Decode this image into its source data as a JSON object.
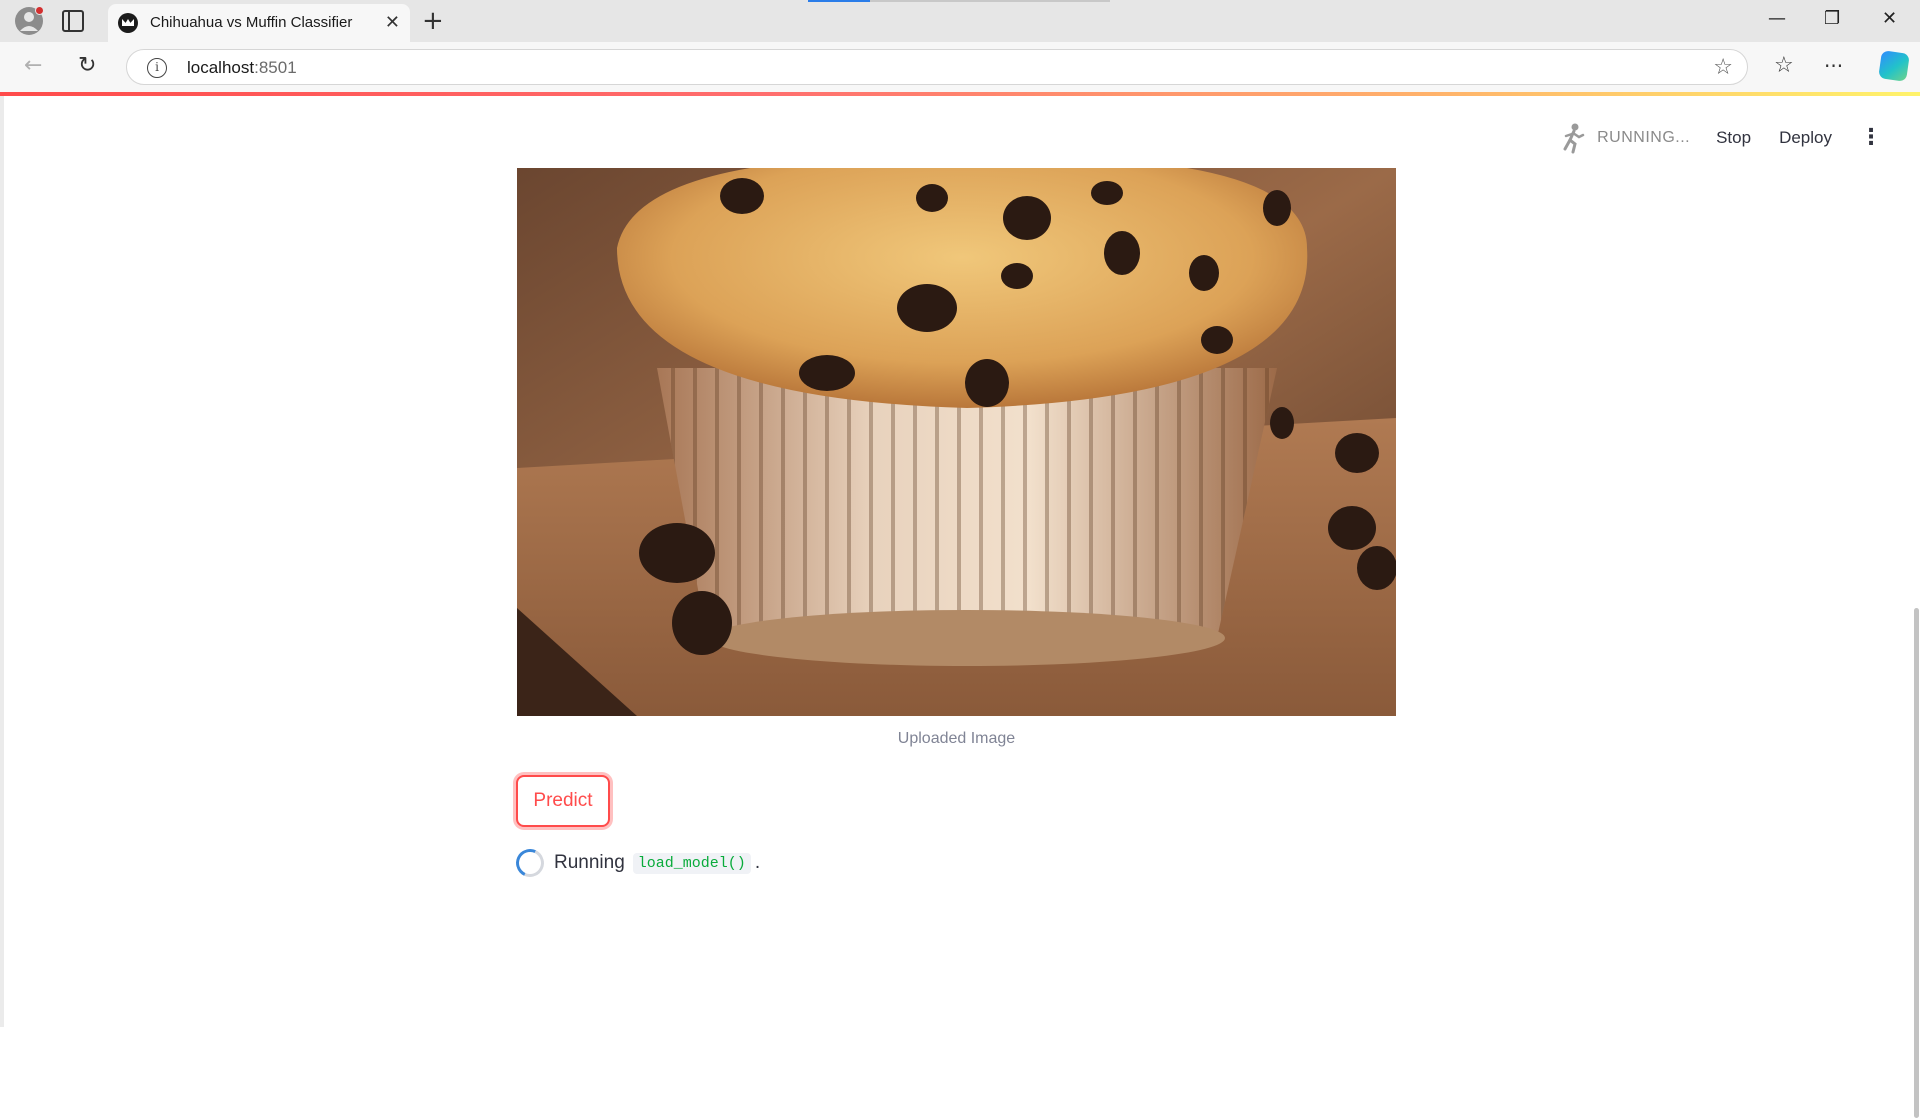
{
  "browser": {
    "tab_title": "Chihuahua vs Muffin Classifier",
    "tab_close": "✕",
    "new_tab": "+",
    "url_host": "localhost",
    "url_port": ":8501",
    "window_controls": {
      "minimize": "—",
      "restore": "❐",
      "close": "✕"
    },
    "nav": {
      "back": "←",
      "reload": "↻",
      "favorites": "☆",
      "more": "···"
    },
    "icons": [
      "profile-icon",
      "tab-actions-icon",
      "streamlit-favicon",
      "back-icon",
      "reload-icon",
      "info-icon",
      "star-icon",
      "favorites-icon",
      "more-icon",
      "copilot-icon"
    ]
  },
  "app": {
    "header": {
      "status_label": "RUNNING...",
      "stop_label": "Stop",
      "deploy_label": "Deploy",
      "menu_glyph": "⋮"
    },
    "image_caption": "Uploaded Image",
    "predict_label": "Predict",
    "status": {
      "prefix": "Running",
      "code": "load_model()",
      "suffix": "."
    }
  },
  "colors": {
    "accent": "#ff4b4b",
    "text": "#31333f",
    "caption": "#808495",
    "code": "#09ab3b",
    "spinner": "#3a87d9"
  }
}
